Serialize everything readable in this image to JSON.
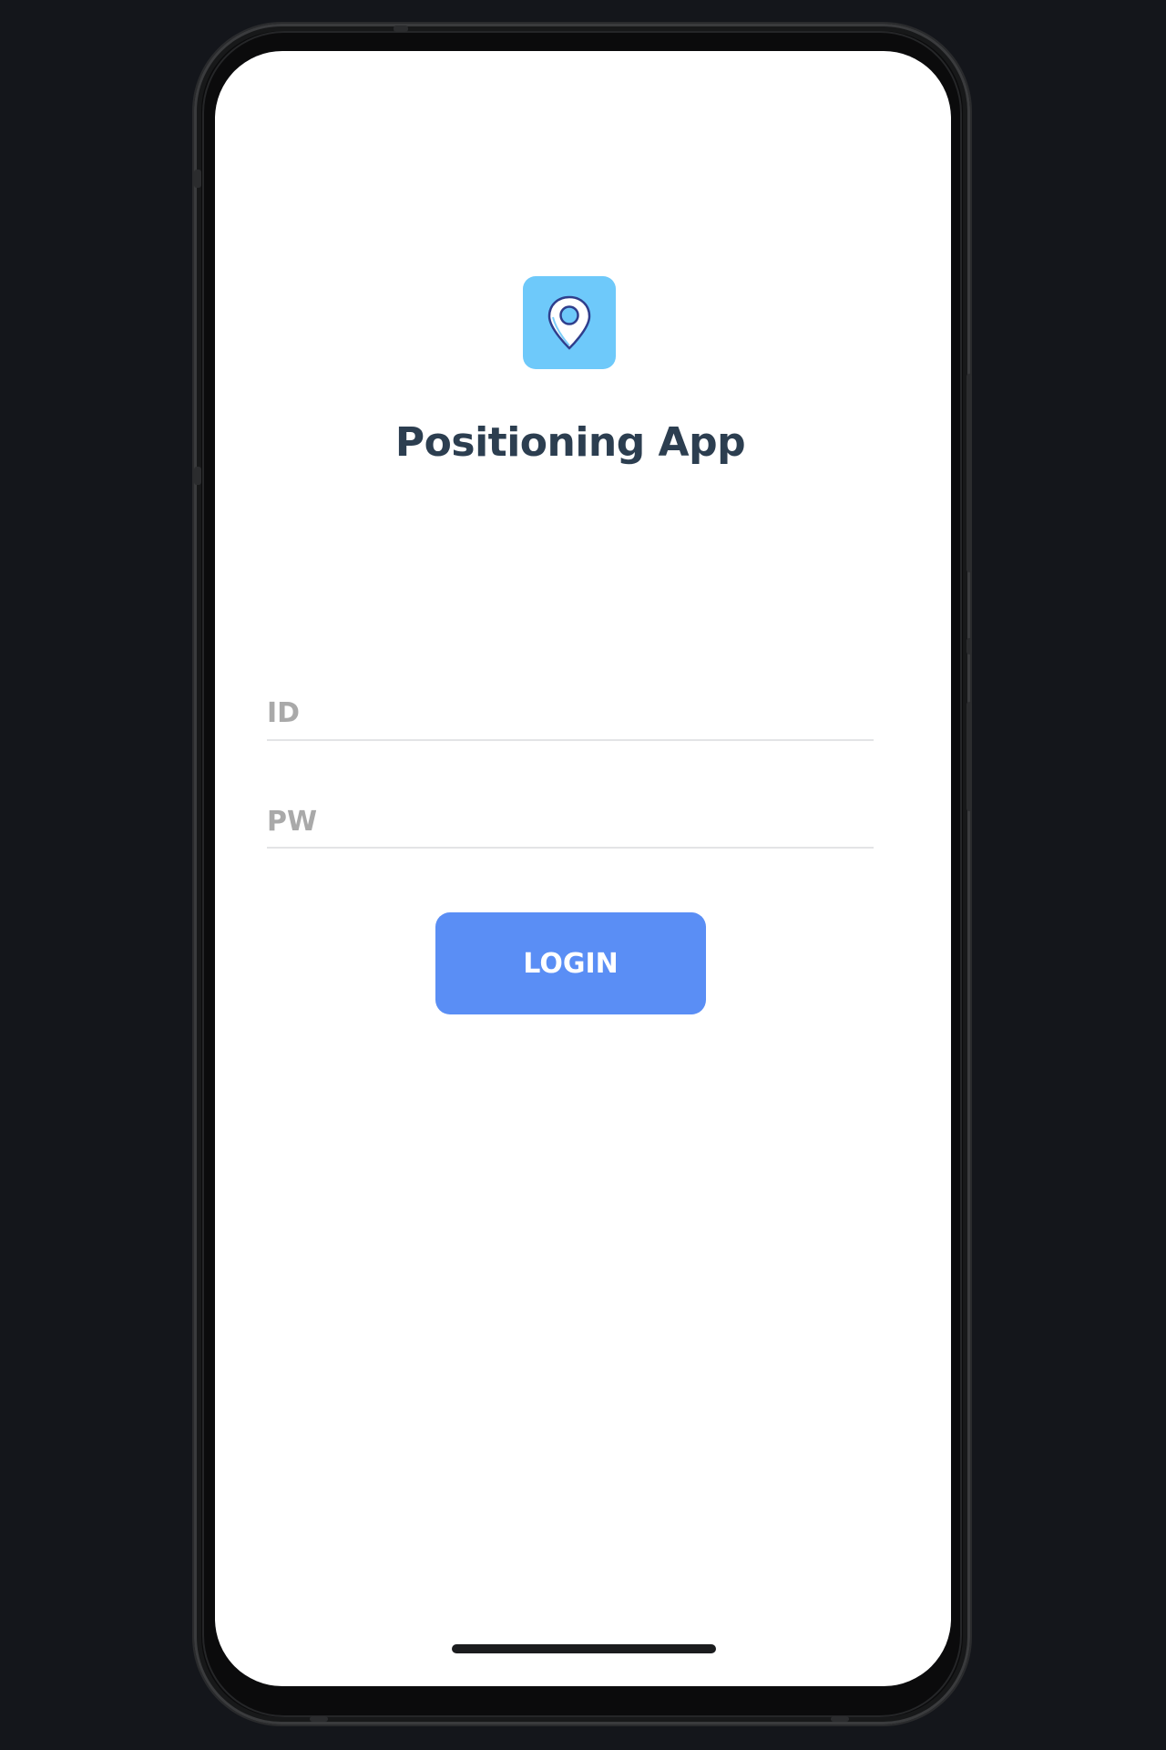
{
  "app": {
    "title": "Positioning App",
    "icon": "location-pin-icon",
    "accent_color": "#6ec9fa"
  },
  "login_form": {
    "id_placeholder": "ID",
    "id_value": "",
    "pw_placeholder": "PW",
    "pw_value": "",
    "login_label": "LOGIN",
    "button_color": "#5a8ef5"
  }
}
